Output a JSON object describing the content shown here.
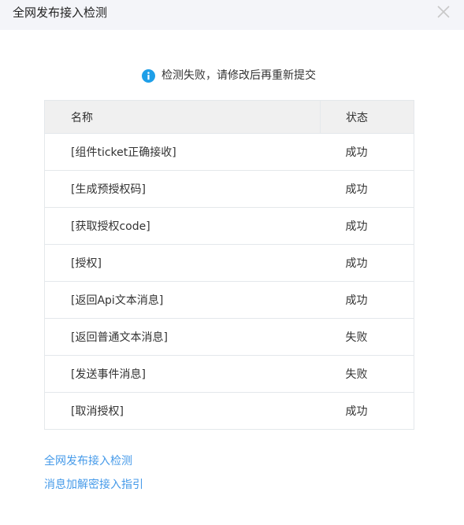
{
  "dialog": {
    "title": "全网发布接入检测"
  },
  "notice": {
    "icon": "info-icon",
    "text": "检测失败，请修改后再重新提交",
    "icon_color": "#1e9fe8"
  },
  "table": {
    "headers": {
      "name": "名称",
      "status": "状态"
    },
    "rows": [
      {
        "name": "[组件ticket正确接收]",
        "status": "成功",
        "state": "ok"
      },
      {
        "name": "[生成预授权码]",
        "status": "成功",
        "state": "ok"
      },
      {
        "name": "[获取授权code]",
        "status": "成功",
        "state": "ok"
      },
      {
        "name": "[授权]",
        "status": "成功",
        "state": "ok"
      },
      {
        "name": "[返回Api文本消息]",
        "status": "成功",
        "state": "ok"
      },
      {
        "name": "[返回普通文本消息]",
        "status": "失败",
        "state": "fail"
      },
      {
        "name": "[发送事件消息]",
        "status": "失败",
        "state": "fail"
      },
      {
        "name": "[取消授权]",
        "status": "成功",
        "state": "ok"
      }
    ]
  },
  "links": {
    "detection": "全网发布接入检测",
    "encryption_guide": "消息加解密接入指引"
  },
  "colors": {
    "link": "#459ae9",
    "fail": "#e15f63",
    "header_bg": "#f4f5f9"
  }
}
